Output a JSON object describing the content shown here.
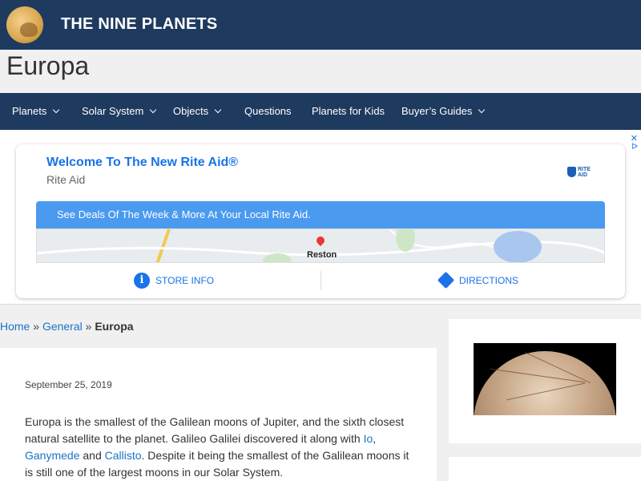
{
  "header": {
    "site_title": "THE NINE PLANETS",
    "bg_color": "#1e3a5f"
  },
  "page": {
    "title": "Europa"
  },
  "nav": {
    "items": [
      {
        "label": "Planets",
        "has_dropdown": true
      },
      {
        "label": "Solar System",
        "has_dropdown": true
      },
      {
        "label": "Objects",
        "has_dropdown": true
      },
      {
        "label": "Questions",
        "has_dropdown": false
      },
      {
        "label": "Planets for Kids",
        "has_dropdown": false
      },
      {
        "label": "Buyer’s Guides",
        "has_dropdown": true
      }
    ]
  },
  "ad": {
    "close_glyph": "✕",
    "adchoices_glyph": "ᐅ",
    "headline": "Welcome To The New Rite Aid®",
    "advertiser": "Rite Aid",
    "logo_text": "RITE AID",
    "banner_text": "See Deals Of The Week & More At Your Local Rite Aid.",
    "map_label": "Reston",
    "store_info_label": "STORE INFO",
    "directions_label": "DIRECTIONS",
    "info_glyph": "i",
    "accent_color": "#1a73e8"
  },
  "breadcrumb": {
    "home": "Home",
    "sep1": " » ",
    "category": "General",
    "sep2": " » ",
    "current": "Europa"
  },
  "post": {
    "date": "September 25, 2019",
    "text_1": "Europa is the smallest of the Galilean moons of Jupiter, and the sixth closest natural satellite to the planet. Galileo Galilei discovered it along with ",
    "link_io": "Io",
    "comma": ", ",
    "link_ganymede": "Ganymede",
    "and": " and ",
    "link_callisto": "Callisto",
    "text_2": ". Despite it being the smallest of the Galilean moons it is still one of the largest moons in our Solar System."
  },
  "link_color": "#1a73c8"
}
